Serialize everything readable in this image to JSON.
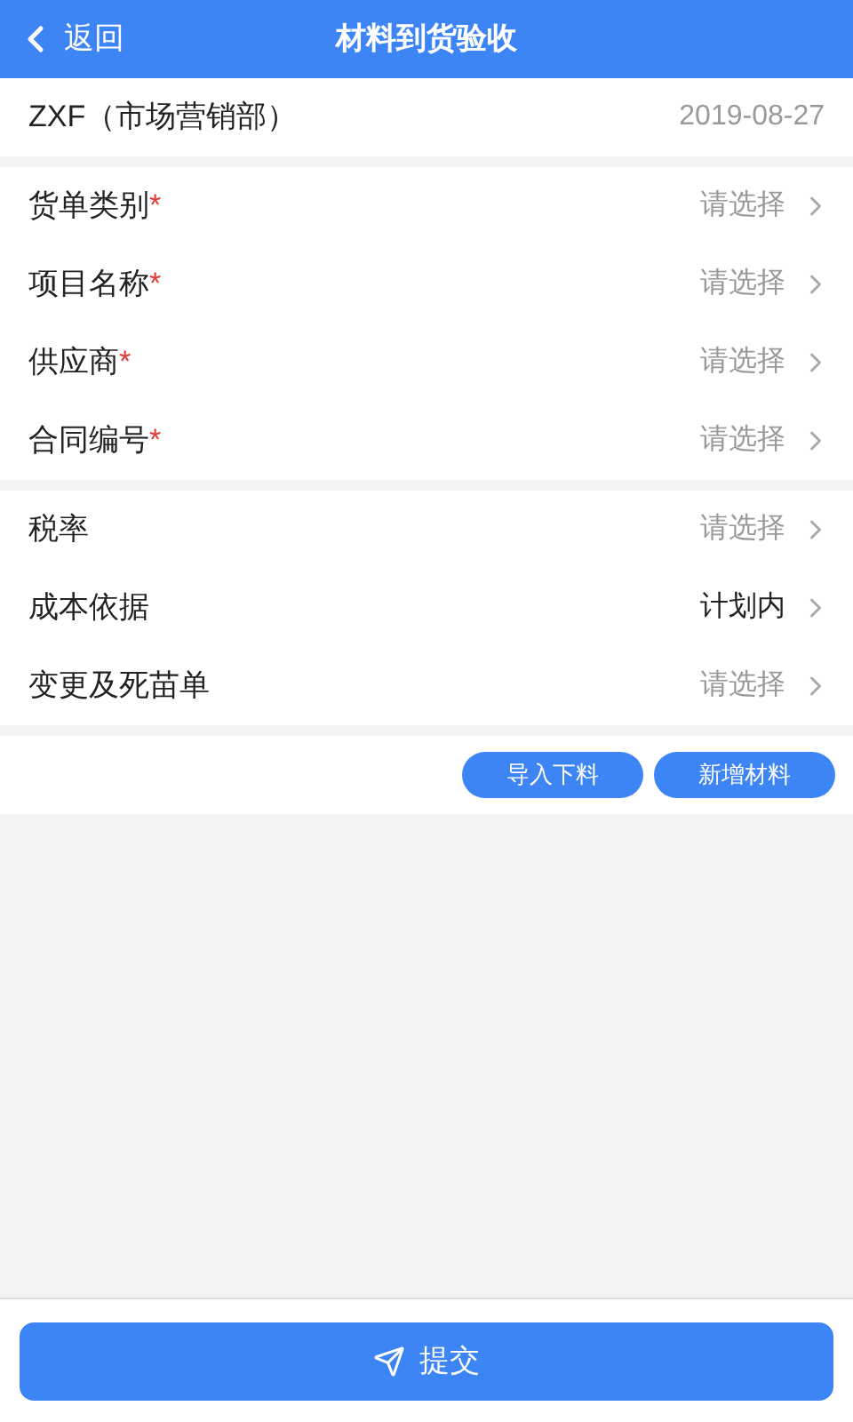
{
  "header": {
    "back": "返回",
    "title": "材料到货验收"
  },
  "info": {
    "name": "ZXF（市场营销部）",
    "date": "2019-08-27"
  },
  "groups": [
    {
      "rows": [
        {
          "label": "货单类别",
          "required": true,
          "placeholder": "请选择"
        },
        {
          "label": "项目名称",
          "required": true,
          "placeholder": "请选择"
        },
        {
          "label": "供应商",
          "required": true,
          "placeholder": "请选择"
        },
        {
          "label": "合同编号",
          "required": true,
          "placeholder": "请选择"
        }
      ]
    },
    {
      "rows": [
        {
          "label": "税率",
          "required": false,
          "placeholder": "请选择"
        },
        {
          "label": "成本依据",
          "required": false,
          "value": "计划内"
        },
        {
          "label": "变更及死苗单",
          "required": false,
          "placeholder": "请选择"
        }
      ]
    }
  ],
  "required_mark": "*",
  "actions": [
    "导入下料",
    "新增材料"
  ],
  "submit": "提交"
}
